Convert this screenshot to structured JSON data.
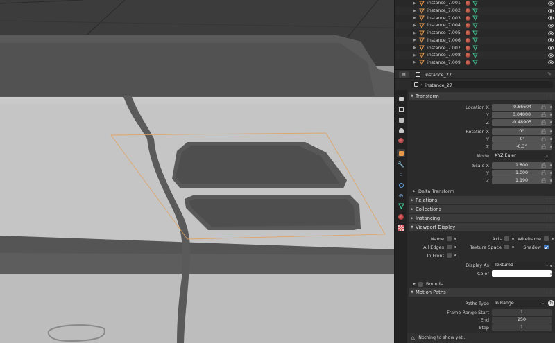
{
  "outliner": {
    "items": [
      {
        "name": "instance_7.001"
      },
      {
        "name": "instance_7.002"
      },
      {
        "name": "instance_7.003"
      },
      {
        "name": "instance_7.004"
      },
      {
        "name": "instance_7.005"
      },
      {
        "name": "instance_7.006"
      },
      {
        "name": "instance_7.007"
      },
      {
        "name": "instance_7.008"
      },
      {
        "name": "instance_7.009"
      }
    ]
  },
  "properties": {
    "header_object": "instance_27",
    "object_name": "instance_27",
    "transform": {
      "title": "Transform",
      "location_label": "Location X",
      "loc_x": "-0.66604",
      "loc_y": "0.04000",
      "loc_z": "-0.48905",
      "rotation_label": "Rotation X",
      "rot_x": "0°",
      "rot_y": "-0°",
      "rot_z": "-0.3°",
      "mode_label": "Mode",
      "mode_value": "XYZ Euler",
      "scale_label": "Scale X",
      "scale_x": "1.800",
      "scale_y": "1.000",
      "scale_z": "1.190",
      "y_label": "Y",
      "z_label": "Z",
      "delta": "Delta Transform"
    },
    "sections": {
      "relations": "Relations",
      "collections": "Collections",
      "instancing": "Instancing",
      "viewport_display": "Viewport Display",
      "bounds": "Bounds",
      "motion_paths": "Motion Paths"
    },
    "viewport_display": {
      "name": "Name",
      "axis": "Axis",
      "wireframe": "Wireframe",
      "all_edges": "All Edges",
      "texture_space": "Texture Space",
      "shadow": "Shadow",
      "in_front": "In Front",
      "display_as_label": "Display As",
      "display_as_value": "Textured",
      "color_label": "Color"
    },
    "motion_paths": {
      "paths_type_label": "Paths Type",
      "paths_type_value": "In Range",
      "frame_start_label": "Frame Range Start",
      "frame_start": "1",
      "end_label": "End",
      "end": "250",
      "step_label": "Step",
      "step": "1"
    },
    "status": "Nothing to show yet..."
  },
  "colors": {
    "accent": "#4772b3",
    "selection_outline": "#e2a05a",
    "mesh_icon": "#3fbf8f",
    "object_icon": "#e89a4a"
  }
}
